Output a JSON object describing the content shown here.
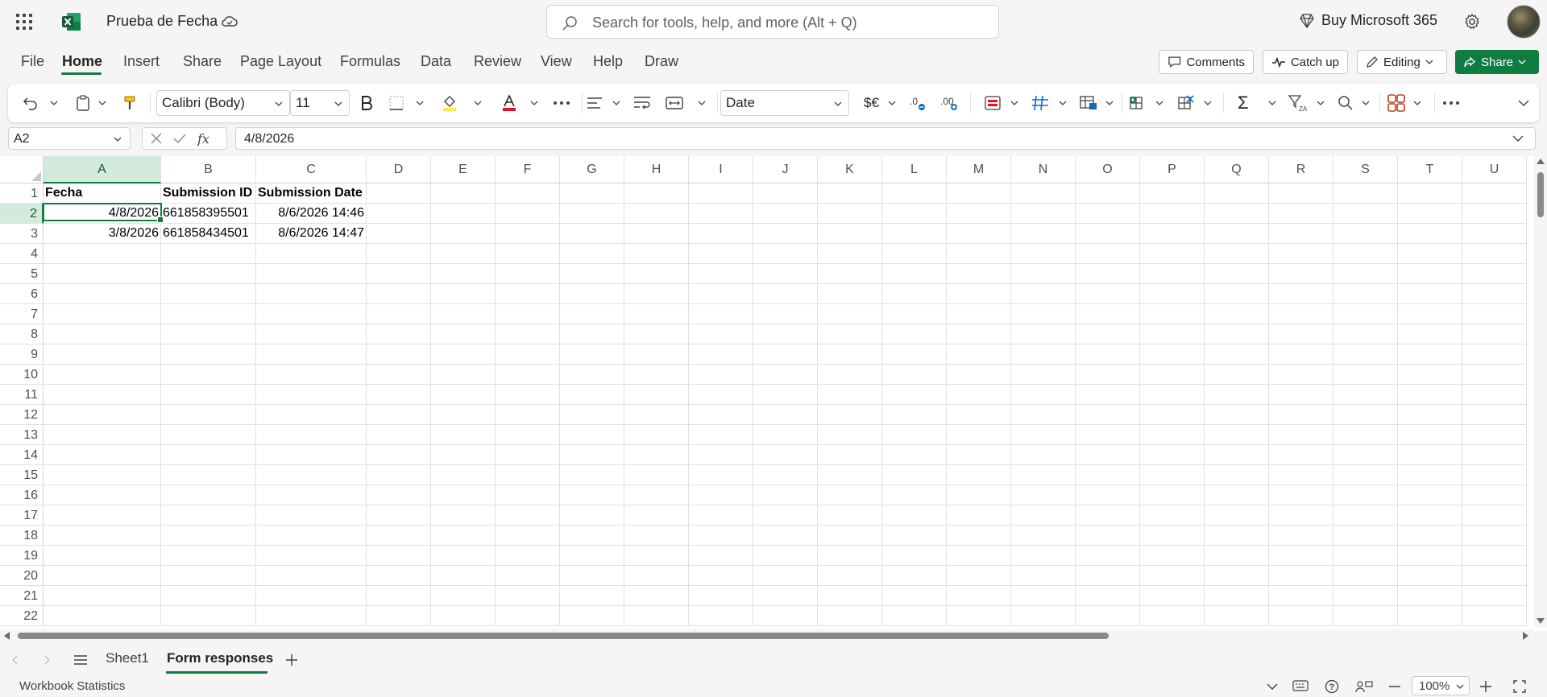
{
  "app": {
    "doc_title": "Prueba de Fecha",
    "search_placeholder": "Search for tools, help, and more (Alt + Q)",
    "buy_label": "Buy Microsoft 365",
    "brand_color": "#107c41"
  },
  "menu": {
    "tabs": [
      "File",
      "Home",
      "Insert",
      "Share",
      "Page Layout",
      "Formulas",
      "Data",
      "Review",
      "View",
      "Help",
      "Draw"
    ],
    "active_tab": "Home",
    "comments_label": "Comments",
    "catchup_label": "Catch up",
    "editing_label": "Editing",
    "share_label": "Share"
  },
  "ribbon": {
    "font_name": "Calibri (Body)",
    "font_size": "11",
    "number_format": "Date",
    "currency_symbol": "$€",
    "sum_symbol": "Σ"
  },
  "formula_bar": {
    "name_box": "A2",
    "fx_label": "fx",
    "formula": "4/8/2026"
  },
  "grid": {
    "columns": [
      "A",
      "B",
      "C",
      "D",
      "E",
      "F",
      "G",
      "H",
      "I",
      "J",
      "K",
      "L",
      "M",
      "N",
      "O",
      "P",
      "Q",
      "R",
      "S",
      "T",
      "U"
    ],
    "rows": [
      "1",
      "2",
      "3",
      "4",
      "5",
      "6",
      "7",
      "8",
      "9",
      "10",
      "11",
      "12",
      "13",
      "14",
      "15",
      "16",
      "17",
      "18",
      "19",
      "20",
      "21",
      "22"
    ],
    "selected_column": "A",
    "selected_row": "2",
    "header_row": [
      "Fecha",
      "Submission ID",
      "Submission Date"
    ],
    "data_rows": [
      [
        "4/8/2026",
        "661858395501",
        "8/6/2026 14:46"
      ],
      [
        "3/8/2026",
        "661858434501",
        "8/6/2026 14:47"
      ]
    ]
  },
  "sheets": {
    "tabs": [
      "Sheet1",
      "Form responses"
    ],
    "active": "Form responses"
  },
  "status": {
    "left_text": "Workbook Statistics",
    "zoom": "100%"
  }
}
